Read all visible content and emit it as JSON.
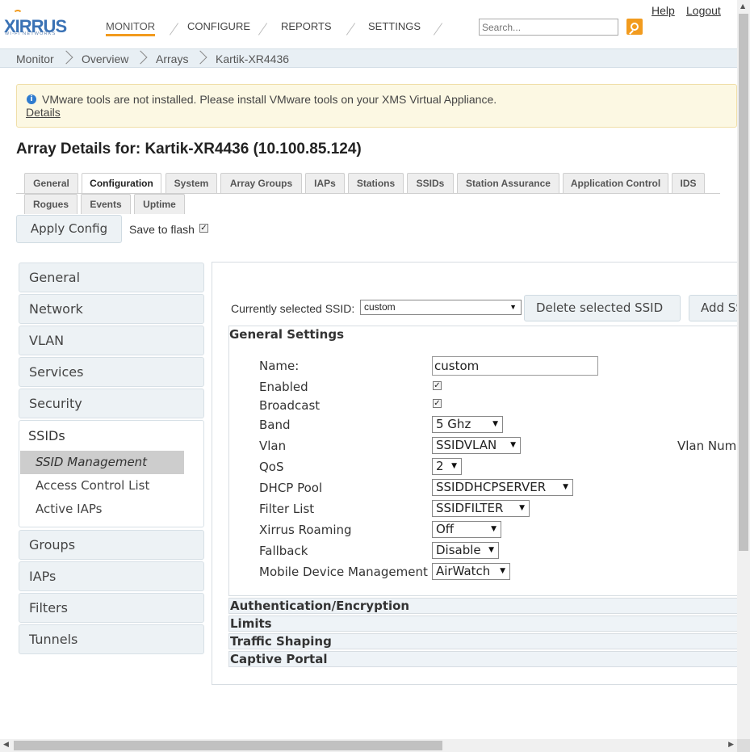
{
  "brand": {
    "name": "XIRRUS",
    "tagline": "WI-FI NETWORKS",
    "accent": "#f29b1e",
    "blue": "#3a72b5"
  },
  "topnav": {
    "items": [
      "MONITOR",
      "CONFIGURE",
      "REPORTS",
      "SETTINGS"
    ],
    "active": "MONITOR"
  },
  "search": {
    "placeholder": "Search..."
  },
  "header_links": {
    "help": "Help",
    "logout": "Logout"
  },
  "breadcrumb": [
    "Monitor",
    "Overview",
    "Arrays",
    "Kartik-XR4436"
  ],
  "alert": {
    "message": "VMware tools are not installed. Please install VMware tools on your XMS Virtual Appliance.",
    "details": "Details",
    "icon": "info-icon"
  },
  "page_title": "Array Details for: Kartik-XR4436 (10.100.85.124)",
  "tabs": [
    "General",
    "Configuration",
    "System",
    "Array Groups",
    "IAPs",
    "Stations",
    "SSIDs",
    "Station Assurance",
    "Application Control",
    "IDS",
    "Rogues",
    "Events",
    "Uptime"
  ],
  "active_tab": "Configuration",
  "actions": {
    "apply_config": "Apply Config",
    "save_to_flash": "Save to flash",
    "save_to_flash_checked": true
  },
  "sidebar": {
    "items_top": [
      "General",
      "Network",
      "VLAN",
      "Services",
      "Security"
    ],
    "group": {
      "label": "SSIDs",
      "sub_items": [
        "SSID Management",
        "Access Control List",
        "Active IAPs"
      ],
      "active_sub": "SSID Management"
    },
    "items_bottom": [
      "Groups",
      "IAPs",
      "Filters",
      "Tunnels"
    ]
  },
  "ssid_bar": {
    "label": "Currently selected SSID:",
    "selected": "custom",
    "delete_button": "Delete selected SSID",
    "add_button": "Add SSID"
  },
  "general_settings": {
    "title": "General Settings",
    "fields": {
      "name": {
        "label": "Name:",
        "value": "custom"
      },
      "enabled": {
        "label": "Enabled",
        "checked": true
      },
      "broadcast": {
        "label": "Broadcast",
        "checked": true
      },
      "band": {
        "label": "Band",
        "value": "5 Ghz"
      },
      "vlan": {
        "label": "Vlan",
        "value": "SSIDVLAN"
      },
      "qos": {
        "label": "QoS",
        "value": "2"
      },
      "dhcp_pool": {
        "label": "DHCP Pool",
        "value": "SSIDDHCPSERVER"
      },
      "filter_list": {
        "label": "Filter List",
        "value": "SSIDFILTER"
      },
      "xirrus_roaming": {
        "label": "Xirrus Roaming",
        "value": "Off"
      },
      "fallback": {
        "label": "Fallback",
        "value": "Disable"
      },
      "mdm": {
        "label": "Mobile Device Management",
        "value": "AirWatch"
      }
    },
    "vlan_number_label": "Vlan Number"
  },
  "sections": [
    "Authentication/Encryption",
    "Limits",
    "Traffic Shaping",
    "Captive Portal"
  ]
}
